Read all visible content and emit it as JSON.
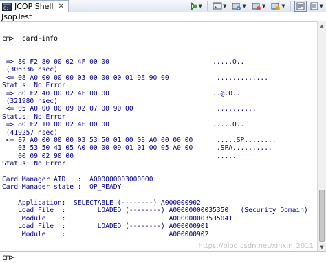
{
  "tab": {
    "title": "JCOP Shell",
    "close": "✕"
  },
  "subheader": {
    "title": "JsopTest"
  },
  "console": {
    "prompt_line": "cm>  card-info",
    "lines": [
      " => 80 F2 80 00 02 4F 00 00                          .....O..",
      " (306336 nsec)",
      " <= 08 A0 00 00 00 03 00 00 00 01 9E 90 00            .............",
      "Status: No Error",
      " => 80 F2 40 00 02 4F 00 00                          ..@.O..",
      " (321980 nsec)",
      " <= 05 A0 00 00 09 02 07 00 90 00                     ..........",
      "Status: No Error",
      " => 80 F2 10 00 02 4F 00 00                          .....O..",
      " (419257 nsec)",
      " <= 07 A0 00 00 00 03 53 50 01 00 08 A0 00 00 00      .....SP........",
      "    03 53 50 41 05 A0 00 00 09 01 01 00 05 A0 00      .SPA..........",
      "    00 09 02 90 00                                    .....",
      "Status: No Error",
      "",
      "Card Manager AID   :  A000000003000000",
      "Card Manager state :  OP_READY",
      "",
      "    Application:  SELECTABLE (--------) A000000902",
      "    Load File  :        LOADED (--------) A00000000035350   (Security Domain)",
      "     Module    :                          A000000003535041",
      "    Load File  :        LOADED (--------) A000000901",
      "     Module    :                          A000000902"
    ]
  },
  "input": {
    "prompt": "cm>",
    "value": ""
  },
  "watermark": "https://blog.csdn.net/xinxin_2011",
  "toolbar": {
    "icons": [
      "run-icon",
      "console-icon",
      "debug-icon",
      "pin-icon",
      "monitor-icon",
      "settings-icon"
    ]
  },
  "colors": {
    "output_text": "#00008b",
    "prompt_text": "#000000",
    "titlebar": "#dfe6ef"
  }
}
